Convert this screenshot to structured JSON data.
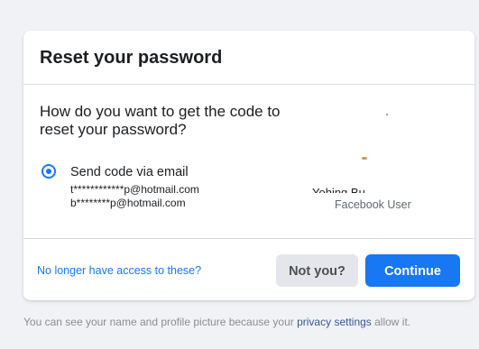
{
  "card": {
    "title": "Reset your password",
    "question": "How do you want to get the code to reset your password?",
    "option": {
      "label": "Send code via email",
      "selected": true,
      "emails": [
        "t************p@hotmail.com",
        "b********p@hotmail.com"
      ]
    },
    "profile": {
      "name": "Yohing Bu",
      "subtitle": "Facebook User"
    },
    "footer": {
      "link": "No longer have access to these?",
      "not_you_label": "Not you?",
      "continue_label": "Continue"
    }
  },
  "bottom_note": {
    "before": "You can see your name and profile picture because your ",
    "link": "privacy settings",
    "after": " allow it."
  },
  "colors": {
    "accent": "#1877f2",
    "background": "#f0f2f5",
    "link": "#385898"
  }
}
